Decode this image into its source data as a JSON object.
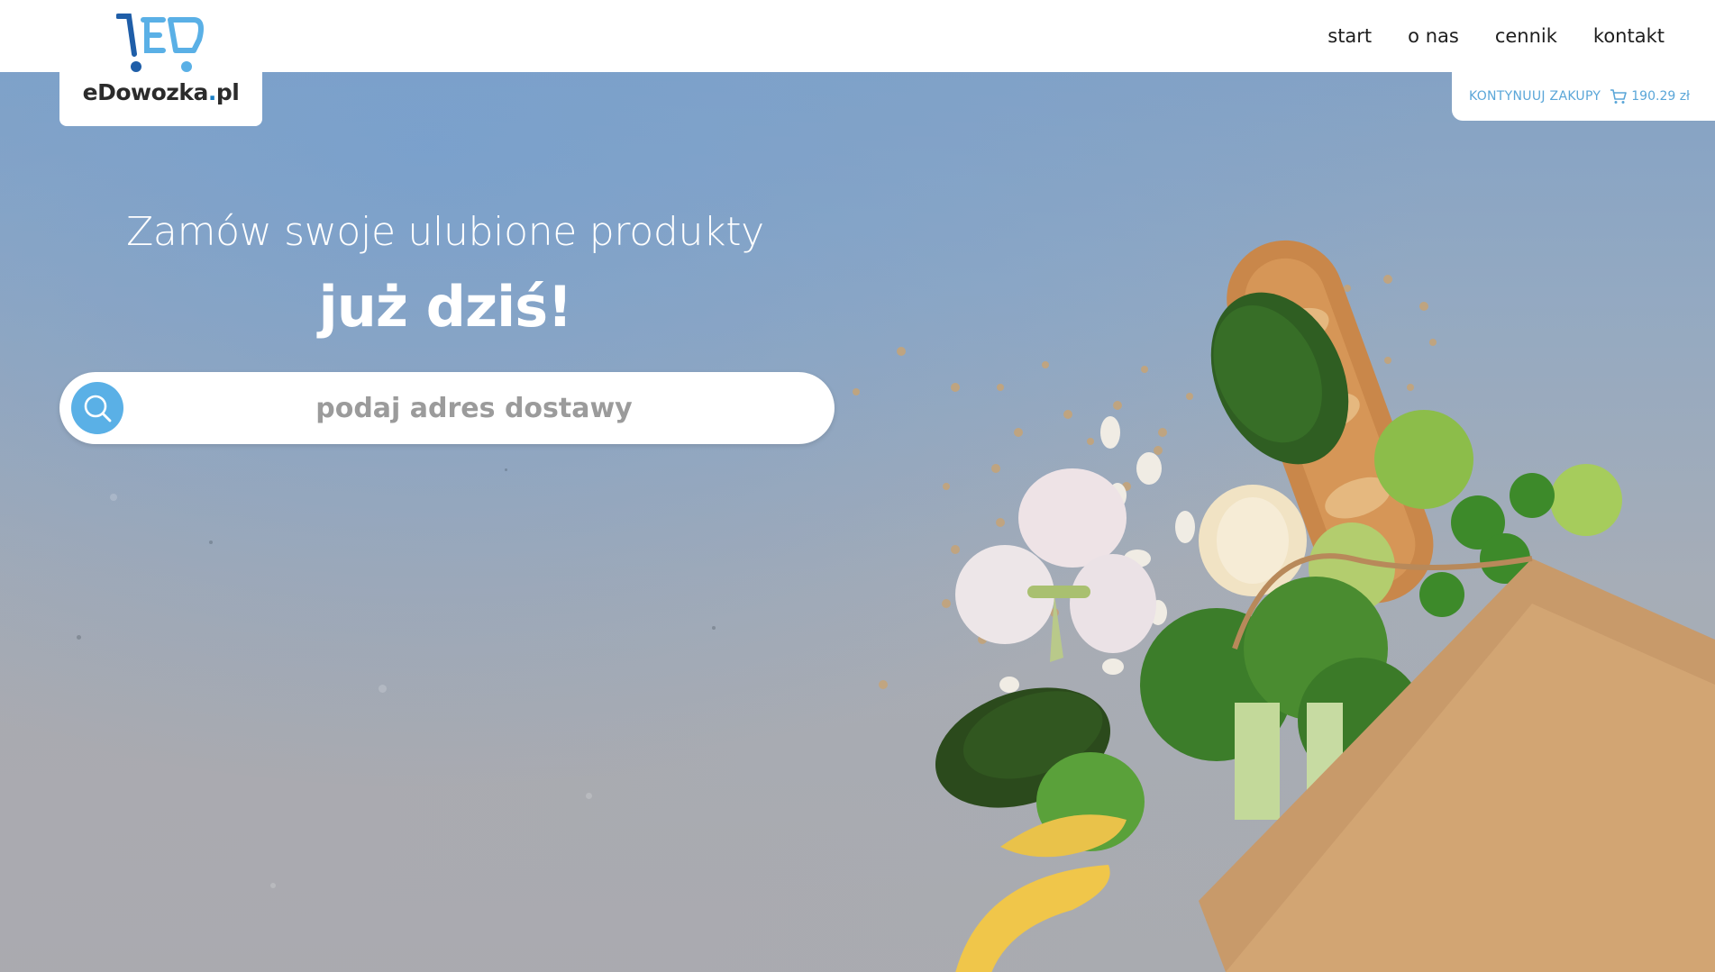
{
  "brand": {
    "name_main": "eDowozka",
    "name_dot": ".",
    "name_tld": "pl",
    "accent_color": "#5ab0e6",
    "icon": "cart-logo-icon"
  },
  "nav": {
    "items": [
      {
        "label": "start"
      },
      {
        "label": "o nas"
      },
      {
        "label": "cennik"
      },
      {
        "label": "kontakt"
      }
    ]
  },
  "cart": {
    "continue_label": "KONTYNUUJ ZAKUPY",
    "total": "190.29 zł",
    "icon": "cart-icon"
  },
  "hero": {
    "headline": "Zamów swoje ulubione produkty",
    "subheadline": "już dziś!"
  },
  "search": {
    "placeholder": "podaj adres dostawy",
    "value": "",
    "icon": "search-icon"
  }
}
